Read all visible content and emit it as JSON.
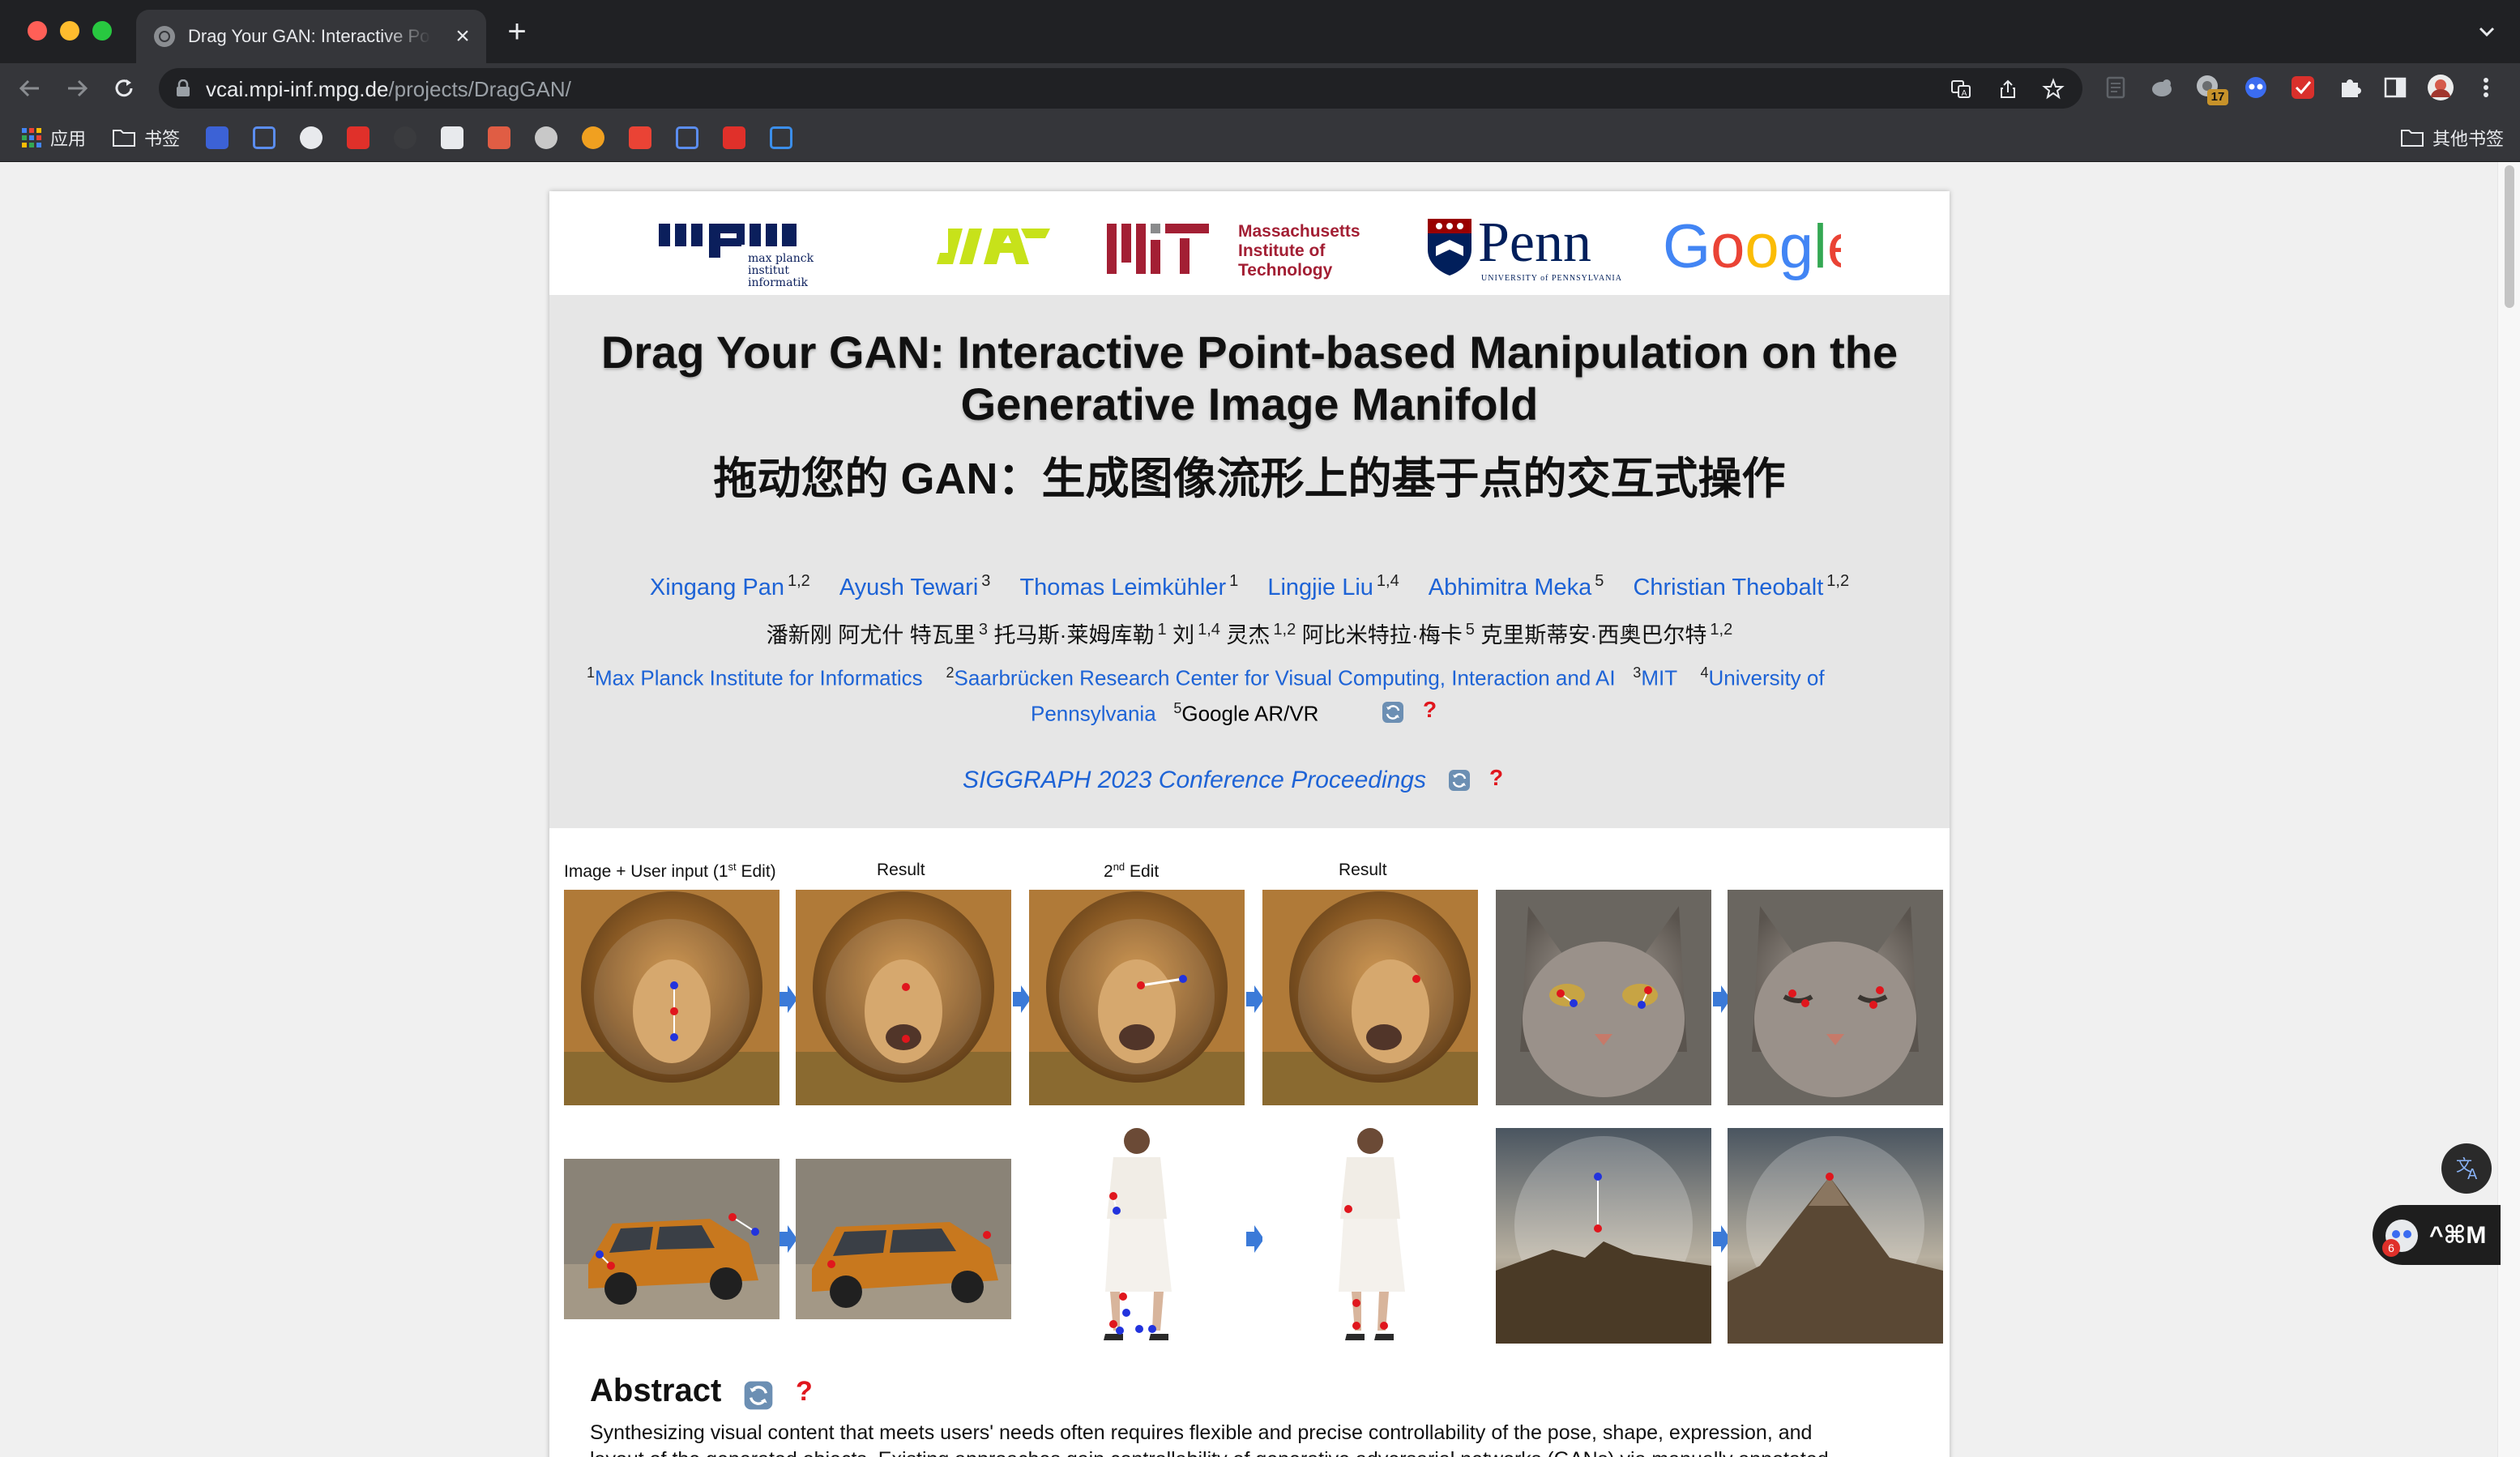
{
  "browser": {
    "tab_title": "Drag Your GAN: Interactive Poi",
    "tab_close": "×",
    "new_tab": "+",
    "url_host": "vcai.mpi-inf.mpg.de",
    "url_path": "/projects/DragGAN/",
    "bookmarks": {
      "apps_label": "应用",
      "bookmarks_label": "书签",
      "other_label": "其他书签"
    },
    "ext_badge": "17"
  },
  "logos": {
    "mpii_text": "max planck institut informatik",
    "mit_name": "Massachusetts Institute of Technology",
    "penn_name": "Penn",
    "penn_sub": "UNIVERSITY of PENNSYLVANIA",
    "google_name": "Google"
  },
  "header": {
    "title_line1": "Drag Your GAN: Interactive Point-based Manipulation on the",
    "title_line2": "Generative Image Manifold",
    "title_zh": "拖动您的 GAN：生成图像流形上的基于点的交互式操作"
  },
  "authors": [
    {
      "name": "Xingang Pan",
      "sup": "1,2"
    },
    {
      "name": "Ayush Tewari",
      "sup": "3"
    },
    {
      "name": "Thomas Leimkühler",
      "sup": "1"
    },
    {
      "name": "Lingjie Liu",
      "sup": "1,4"
    },
    {
      "name": "Abhimitra Meka",
      "sup": "5"
    },
    {
      "name": "Christian Theobalt",
      "sup": "1,2"
    }
  ],
  "authors_zh": {
    "a": "潘新刚 阿尤什 特瓦里",
    "a_sup": "3",
    "b": "托马斯·莱姆库勒",
    "b_sup": "1",
    "c": "刘",
    "c_sup": "1,4",
    "d": "灵杰",
    "d_sup": "1,2",
    "e": "阿比米特拉·梅卡",
    "e_sup": "5",
    "f": "克里斯蒂安·西奥巴尔特",
    "f_sup": "1,2"
  },
  "affiliations": [
    {
      "sup": "1",
      "name": "Max Planck Institute for Informatics"
    },
    {
      "sup": "2",
      "name": "Saarbrücken Research Center for Visual Computing, Interaction and AI"
    },
    {
      "sup": "3",
      "name": "MIT"
    },
    {
      "sup": "4",
      "name": "University of"
    },
    {
      "name": "Pennsylvania"
    },
    {
      "sup": "5",
      "name": "Google AR/VR"
    }
  ],
  "conference": "SIGGRAPH 2023 Conference Proceedings",
  "question_mark": "?",
  "teaser": {
    "cap1_pre": "Image + User input (1",
    "cap1_sup": "st",
    "cap1_post": " Edit)",
    "cap2": "Result",
    "cap3_pre": "2",
    "cap3_sup": "nd",
    "cap3_post": " Edit",
    "cap4": "Result"
  },
  "abstract": {
    "heading": "Abstract",
    "text_line1": "Synthesizing visual content that meets users' needs often requires flexible and precise controllability of the pose, shape, expression, and",
    "text_line2": "layout of the generated objects. Existing approaches gain controllability of generative adversarial networks (GANs) via manually annotated"
  },
  "widgets": {
    "shortcut": "^⌘M",
    "badge": "6"
  },
  "colors": {
    "link": "#1d63d6",
    "chrome_bg": "#202124",
    "toolbar_bg": "#35363a",
    "title_block_bg": "#e6e6e6",
    "handle_point": "#e0161d",
    "target_point": "#2233dd"
  }
}
